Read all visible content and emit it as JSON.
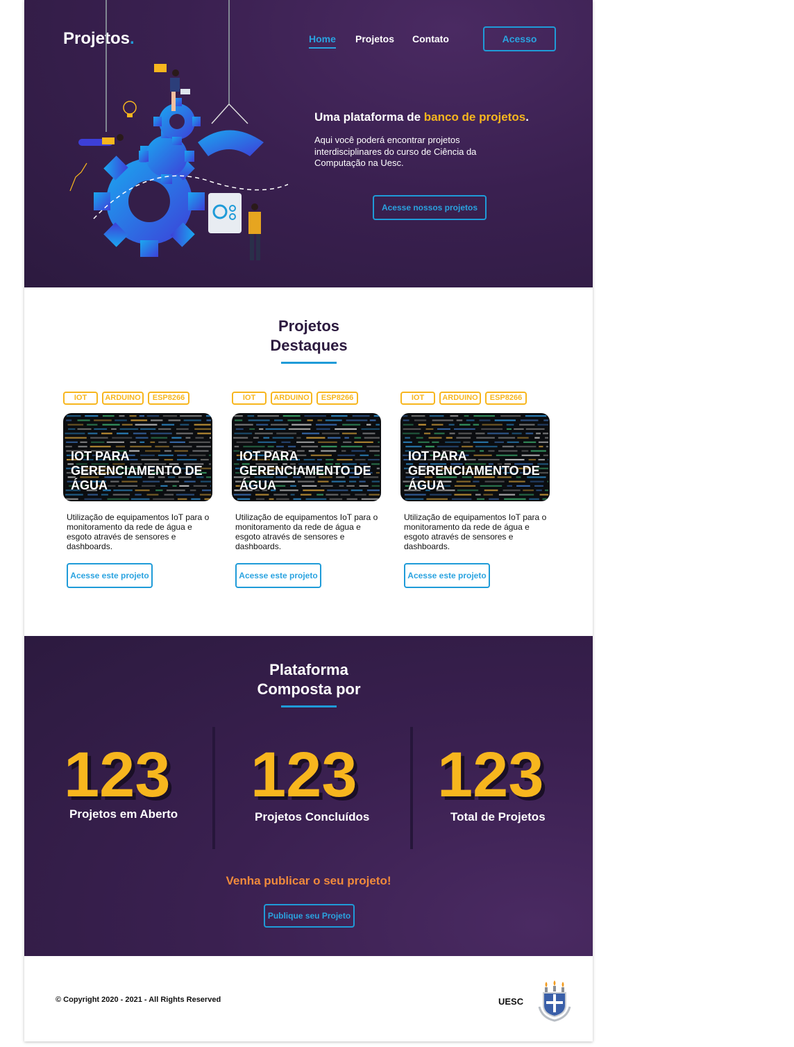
{
  "header": {
    "logo": "Projetos",
    "logo_dot": ".",
    "nav": [
      "Home",
      "Projetos",
      "Contato"
    ],
    "login_button": "Acesso"
  },
  "hero": {
    "title_prefix": "Uma plataforma de ",
    "title_highlight": "banco de projetos",
    "title_suffix": ".",
    "description": "Aqui você poderá encontrar projetos interdisciplinares do curso de Ciência da Computação na Uesc.",
    "cta_button": "Acesse nossos projetos"
  },
  "featured": {
    "title_line1": "Projetos",
    "title_line2": "Destaques",
    "cards": [
      {
        "tags": [
          "IOT",
          "ARDUINO",
          "ESP8266"
        ],
        "title": "IOT PARA GERENCIAMENTO DE ÁGUA",
        "description": "Utilização de equipamentos IoT para o monitoramento da rede de água e esgoto através de sensores e dashboards.",
        "button": "Acesse este projeto"
      },
      {
        "tags": [
          "IOT",
          "ARDUINO",
          "ESP8266"
        ],
        "title": "IOT PARA GERENCIAMENTO DE ÁGUA",
        "description": "Utilização de equipamentos IoT para o monitoramento da rede de água e esgoto através de sensores e dashboards.",
        "button": "Acesse este projeto"
      },
      {
        "tags": [
          "IOT",
          "ARDUINO",
          "ESP8266"
        ],
        "title": "IOT PARA GERENCIAMENTO DE ÁGUA",
        "description": "Utilização de equipamentos IoT para o monitoramento da rede de água e esgoto através de sensores e dashboards.",
        "button": "Acesse este projeto"
      }
    ]
  },
  "stats": {
    "title_line1": "Plataforma",
    "title_line2": "Composta por",
    "items": [
      {
        "value": "123",
        "label": "Projetos em Aberto"
      },
      {
        "value": "123",
        "label": "Projetos Concluídos"
      },
      {
        "value": "123",
        "label": "Total de Projetos"
      }
    ],
    "cta_text": "Venha publicar o seu projeto!",
    "cta_button": "Publique seu Projeto"
  },
  "footer": {
    "copyright": "© Copyright 2020 - 2021 - All Rights Reserved",
    "institution": "UESC"
  },
  "colors": {
    "primary_dark": "#2c1a3f",
    "accent_blue": "#1f9bd8",
    "accent_yellow": "#f7b61e",
    "accent_orange": "#f08a3c"
  }
}
